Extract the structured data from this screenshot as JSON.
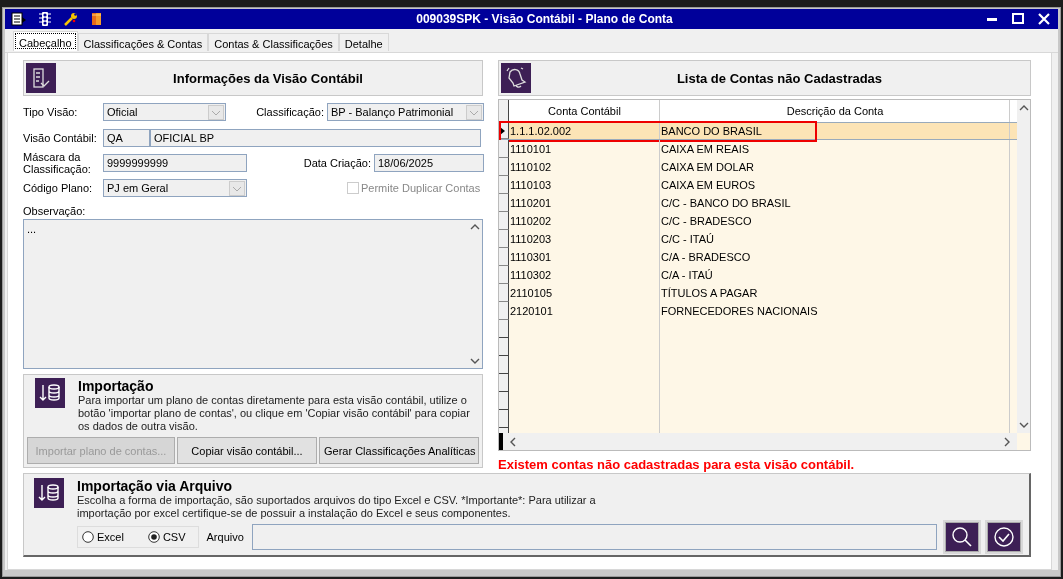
{
  "window": {
    "title": "009039SPK - Visão Contábil - Plano de Conta"
  },
  "tabs": [
    {
      "label": "Cabeçalho",
      "selected": true
    },
    {
      "label": "Classificações & Contas",
      "selected": false
    },
    {
      "label": "Contas & Classificações",
      "selected": false
    },
    {
      "label": "Detalhe",
      "selected": false
    }
  ],
  "info_panel": {
    "title": "Informações da Visão Contábil",
    "tipo_visao": {
      "label": "Tipo Visão:",
      "value": "Oficial"
    },
    "classificacao": {
      "label": "Classificação:",
      "value": "BP - Balanço Patrimonial"
    },
    "visao_contabil": {
      "label": "Visão Contábil:",
      "code": "QA",
      "name": "OFICIAL BP"
    },
    "mascara": {
      "label": "Máscara da Classificação:",
      "value": "9999999999"
    },
    "data_criacao": {
      "label": "Data Criação:",
      "value": "18/06/2025"
    },
    "codigo_plano": {
      "label": "Código Plano:",
      "value": "PJ em Geral"
    },
    "permite_duplicar": {
      "label": "Permite Duplicar Contas",
      "checked": false,
      "disabled": true
    },
    "observacao": {
      "label": "Observação:",
      "value": "..."
    }
  },
  "importacao": {
    "title": "Importação",
    "text": "Para importar um plano de contas diretamente para esta visão contábil, utilize o botão 'importar plano de contas', ou clique em 'Copiar visão contábil' para copiar os dados de outra visão.",
    "buttons": [
      {
        "label": "Importar plano de contas...",
        "disabled": true
      },
      {
        "label": "Copiar visão contábil...",
        "disabled": false
      },
      {
        "label": "Gerar Classificações Analíticas",
        "disabled": false
      }
    ]
  },
  "contas_panel": {
    "title": "Lista de Contas não Cadastradas",
    "columns": [
      "Conta Contábil",
      "Descrição da Conta"
    ],
    "rows": [
      {
        "conta": "1.1.1.02.002",
        "descricao": "BANCO DO BRASIL",
        "selected": true,
        "highlighted": true
      },
      {
        "conta": "1110101",
        "descricao": "CAIXA EM REAIS",
        "selected": false,
        "highlighted": false
      },
      {
        "conta": "1110102",
        "descricao": "CAIXA EM DOLAR",
        "selected": false,
        "highlighted": false
      },
      {
        "conta": "1110103",
        "descricao": "CAIXA EM EUROS",
        "selected": false,
        "highlighted": false
      },
      {
        "conta": "1110201",
        "descricao": "C/C - BANCO DO BRASIL",
        "selected": false,
        "highlighted": false
      },
      {
        "conta": "1110202",
        "descricao": "C/C - BRADESCO",
        "selected": false,
        "highlighted": false
      },
      {
        "conta": "1110203",
        "descricao": "C/C - ITAÚ",
        "selected": false,
        "highlighted": false
      },
      {
        "conta": "1110301",
        "descricao": "C/A - BRADESCO",
        "selected": false,
        "highlighted": false
      },
      {
        "conta": "1110302",
        "descricao": "C/A - ITAÚ",
        "selected": false,
        "highlighted": false
      },
      {
        "conta": "2110105",
        "descricao": "TÍTULOS A PAGAR",
        "selected": false,
        "highlighted": false
      },
      {
        "conta": "2120101",
        "descricao": "FORNECEDORES NACIONAIS",
        "selected": false,
        "highlighted": false
      }
    ],
    "warning": "Existem contas não cadastradas para esta visão contábil."
  },
  "importacao_arquivo": {
    "title": "Importação via Arquivo",
    "text": "Escolha a forma de importação, são suportados arquivos do tipo Excel e CSV. *Importante*: Para utilizar a importação por excel certifique-se de possuir a instalação do Excel e seus componentes.",
    "formats": [
      {
        "label": "Excel",
        "selected": false
      },
      {
        "label": "CSV",
        "selected": true
      }
    ],
    "file_label": "Arquivo"
  }
}
